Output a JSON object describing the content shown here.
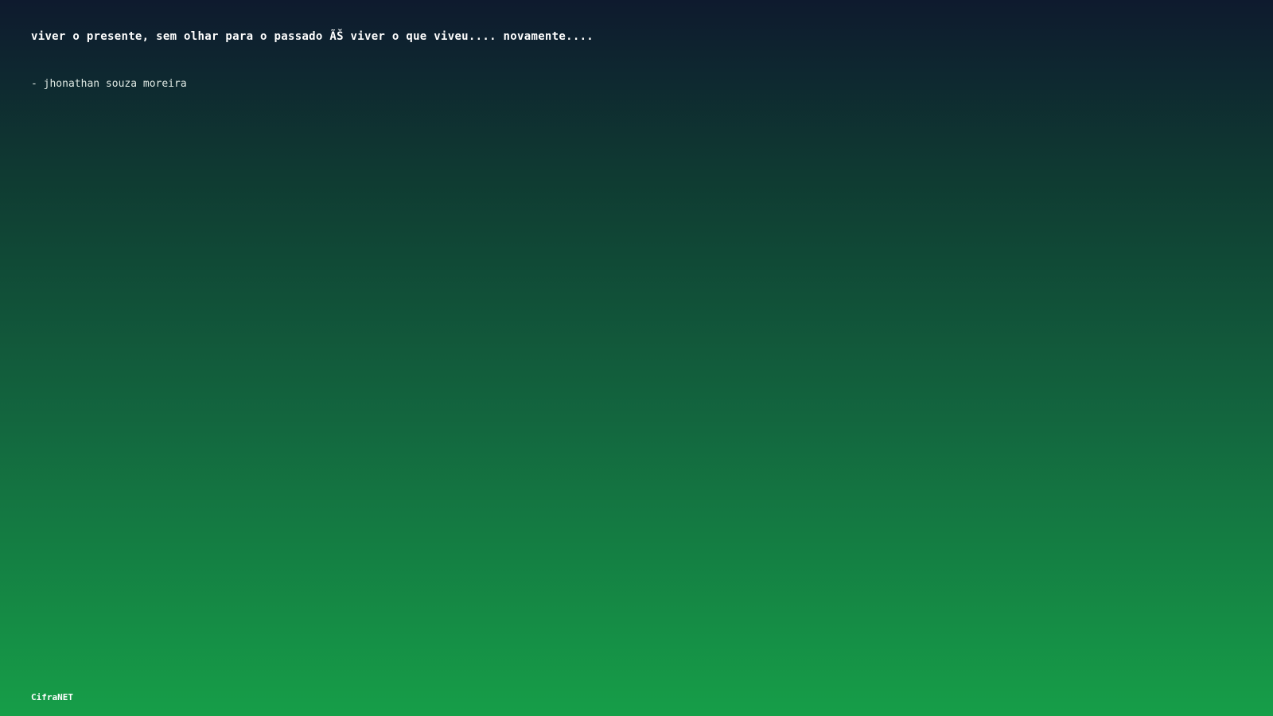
{
  "quote": {
    "text": "viver o presente, sem olhar para o passado ÃŠ viver o que viveu.... novamente....",
    "author": "- jhonathan souza moreira"
  },
  "footer": {
    "brand": "CifraNET"
  },
  "colors": {
    "gradient_top": "#0e1a2e",
    "gradient_bottom": "#169e48",
    "text": "#ffffff"
  }
}
